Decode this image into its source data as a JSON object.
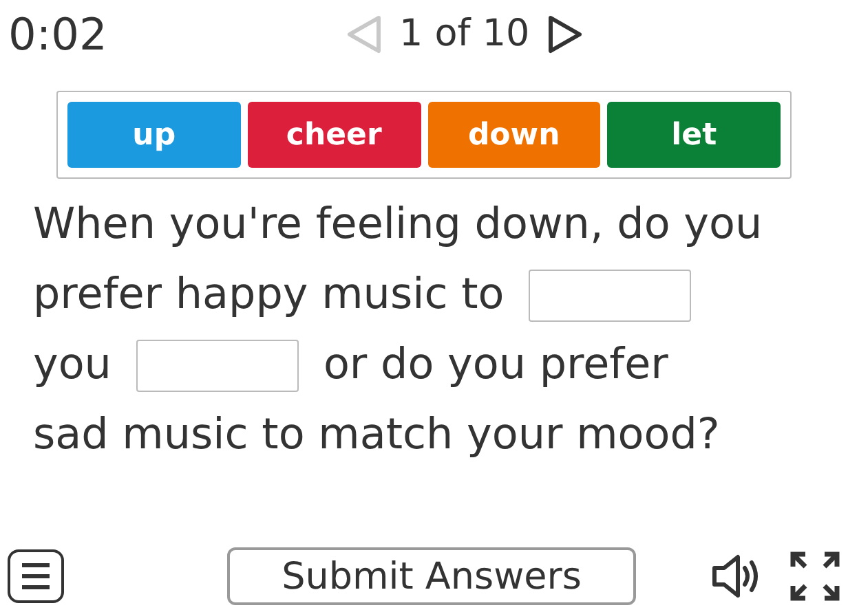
{
  "timer": "0:02",
  "pager": {
    "text": "1 of 10",
    "previous_disabled": true,
    "next_disabled": false
  },
  "word_tiles": [
    {
      "text": "up",
      "color": "#1c9ae0"
    },
    {
      "text": "cheer",
      "color": "#dc1f3a"
    },
    {
      "text": "down",
      "color": "#ef7100"
    },
    {
      "text": "let",
      "color": "#0a8136"
    }
  ],
  "question_lines": [
    [
      {
        "kind": "text",
        "text": "When you're feeling down, do you"
      }
    ],
    [
      {
        "kind": "text",
        "text": "prefer happy music to"
      },
      {
        "kind": "blank"
      }
    ],
    [
      {
        "kind": "text",
        "text": "you"
      },
      {
        "kind": "blank"
      },
      {
        "kind": "text",
        "text": "or do you prefer"
      }
    ],
    [
      {
        "kind": "text",
        "text": "sad music to match your mood?"
      }
    ]
  ],
  "submit_button": "Submit Answers"
}
